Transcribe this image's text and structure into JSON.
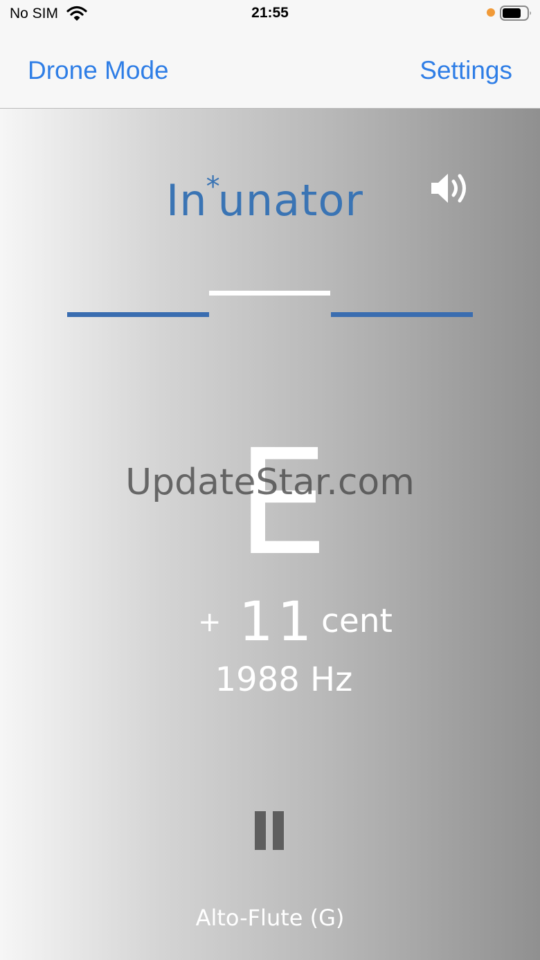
{
  "status_bar": {
    "carrier": "No SIM",
    "time": "21:55",
    "icons": [
      "wifi-icon",
      "battery-icon"
    ],
    "mic_indicator_color": "#f19a38"
  },
  "nav": {
    "left_label": "Drone Mode",
    "right_label": "Settings",
    "tint_color": "#2f7ee6"
  },
  "tuner": {
    "logo_parts": [
      "In",
      "*",
      "unator"
    ],
    "logo_color": "#3a74b4",
    "speaker_icon": "speaker-volume-icon",
    "meter_color": "#3a6db0",
    "note": "E",
    "cents_sign": "+",
    "cents_value": "11",
    "cents_unit": "cent",
    "frequency": "1988 Hz",
    "pause_icon": "pause-icon",
    "instrument": "Alto-Flute (G)"
  },
  "watermark": "UpdateStar.com"
}
